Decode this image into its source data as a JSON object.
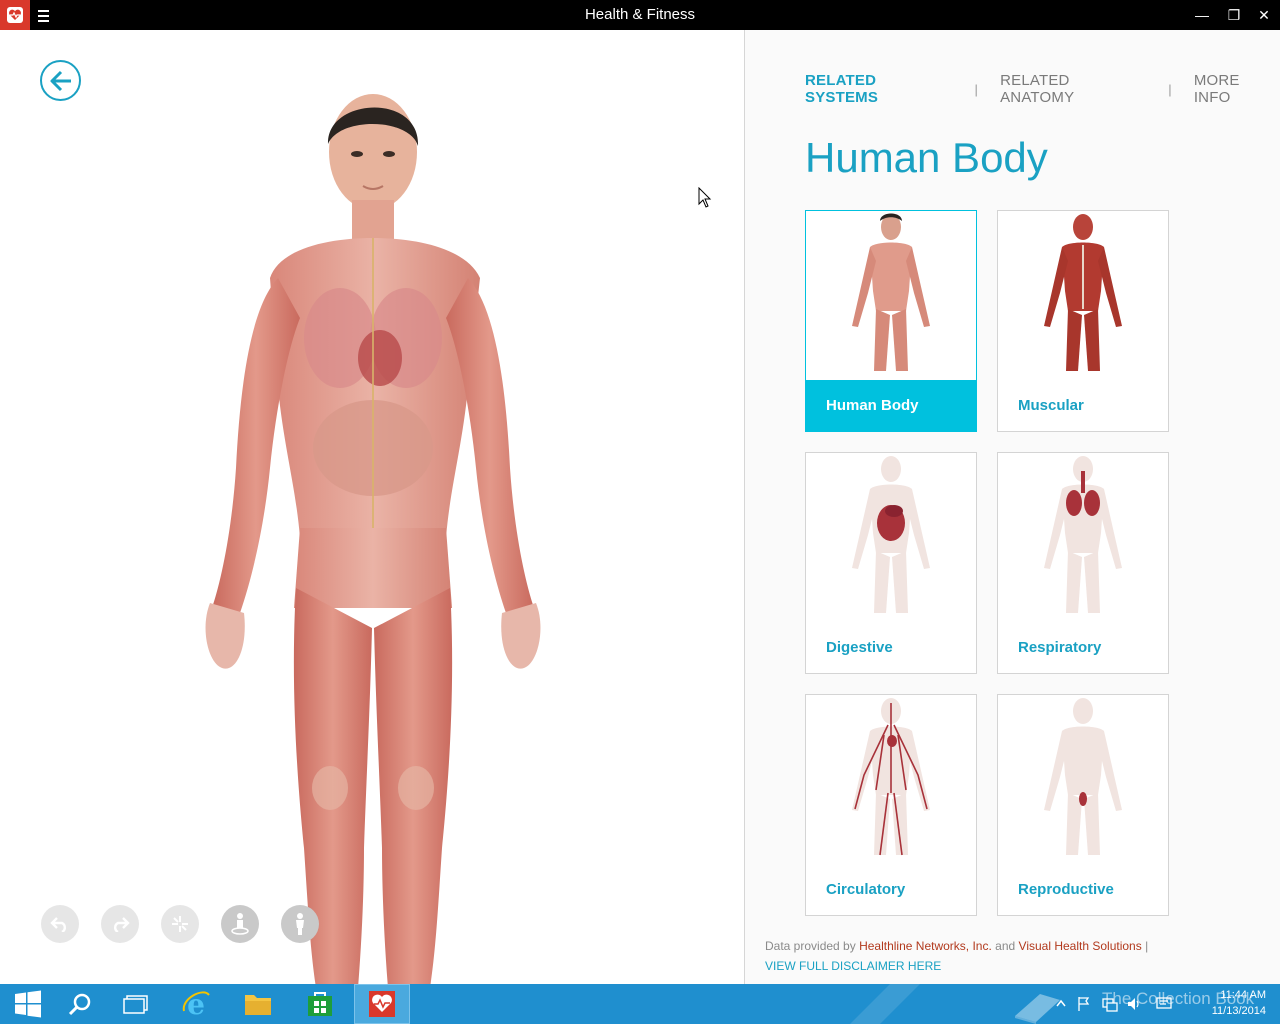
{
  "window": {
    "title": "Health & Fitness",
    "minimize_glyph": "—",
    "restore_glyph": "❐",
    "close_glyph": "✕"
  },
  "tabs": [
    {
      "label": "RELATED SYSTEMS",
      "active": true
    },
    {
      "label": "RELATED ANATOMY",
      "active": false
    },
    {
      "label": "MORE INFO",
      "active": false
    }
  ],
  "tab_separator": "|",
  "section_title": "Human Body",
  "tiles": [
    {
      "label": "Human Body",
      "selected": true,
      "icon": "human-body-figure"
    },
    {
      "label": "Muscular",
      "selected": false,
      "icon": "muscular-figure"
    },
    {
      "label": "Digestive",
      "selected": false,
      "icon": "digestive-figure"
    },
    {
      "label": "Respiratory",
      "selected": false,
      "icon": "respiratory-figure"
    },
    {
      "label": "Circulatory",
      "selected": false,
      "icon": "circulatory-figure"
    },
    {
      "label": "Reproductive",
      "selected": false,
      "icon": "reproductive-figure"
    }
  ],
  "footer": {
    "prefix": "Data provided by",
    "source1": "Healthline Networks, Inc.",
    "and": "and",
    "source2": "Visual Health Solutions",
    "sep": "|",
    "disclaimer": "VIEW FULL DISCLAIMER HERE"
  },
  "taskbar": {
    "time": "11:44 AM",
    "date": "11/13/2014",
    "watermark": "The Collection Book"
  },
  "colors": {
    "accent": "#1aa1c3",
    "selected_tile": "#00c1de",
    "app_icon": "#d9382b",
    "taskbar": "#1f8fcf"
  }
}
